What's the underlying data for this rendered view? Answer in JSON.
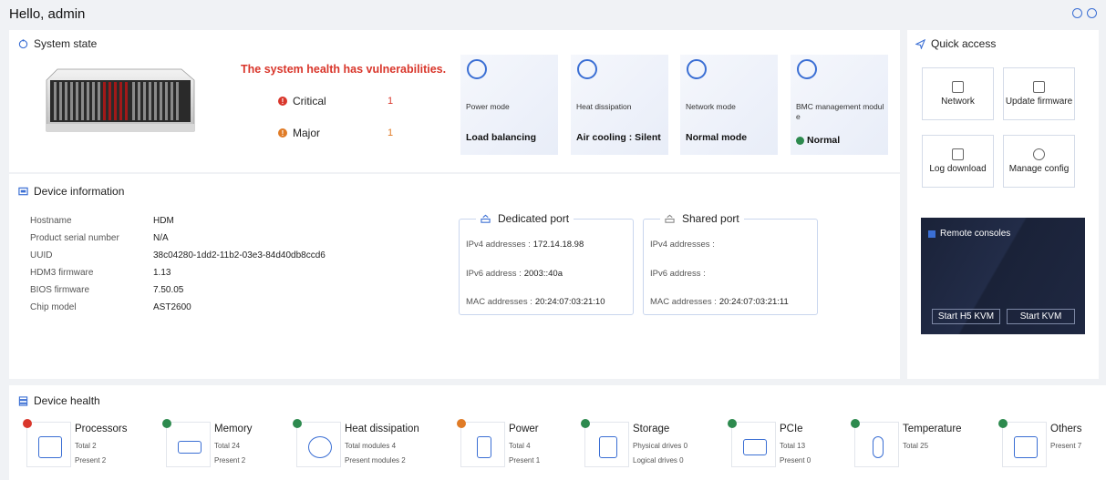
{
  "greeting": "Hello, admin",
  "colors": {
    "critical": "#d9362b",
    "major": "#e07b26",
    "ok": "#2d8a4e",
    "accent": "#3b6fd4"
  },
  "system_state": {
    "title": "System state",
    "alert": "The system health has vulnerabilities.",
    "critical_label": "Critical",
    "critical_count": "1",
    "major_label": "Major",
    "major_count": "1",
    "cards": [
      {
        "label": "Power mode",
        "value": "Load balancing",
        "icon": "power-icon"
      },
      {
        "label": "Heat dissipation",
        "value": "Air cooling : Silent",
        "icon": "fan-icon"
      },
      {
        "label": "Network mode",
        "value": "Normal mode",
        "icon": "network-icon"
      },
      {
        "label": "BMC management modul e",
        "value": "Normal",
        "icon": "bmc-icon"
      }
    ]
  },
  "device_info": {
    "title": "Device information",
    "rows": [
      {
        "label": "Hostname",
        "value": "HDM"
      },
      {
        "label": "Product serial number",
        "value": "N/A"
      },
      {
        "label": "UUID",
        "value": "38c04280-1dd2-11b2-03e3-84d40db8ccd6"
      },
      {
        "label": "HDM3 firmware",
        "value": "1.13"
      },
      {
        "label": "BIOS firmware",
        "value": "7.50.05"
      },
      {
        "label": "Chip model",
        "value": "AST2600"
      }
    ],
    "dedicated": {
      "title": "Dedicated port",
      "ipv4_label": "IPv4 addresses :",
      "ipv4": "172.14.18.98",
      "ipv6_label": "IPv6 address :",
      "ipv6": "2003::40a",
      "mac_label": "MAC addresses :",
      "mac": "20:24:07:03:21:10"
    },
    "shared": {
      "title": "Shared port",
      "ipv4_label": "IPv4 addresses :",
      "ipv4": "",
      "ipv6_label": "IPv6 address :",
      "ipv6": "",
      "mac_label": "MAC addresses :",
      "mac": "20:24:07:03:21:11"
    }
  },
  "quick_access": {
    "title": "Quick access",
    "buttons": [
      "Network",
      "Update firmware",
      "Log download",
      "Manage config"
    ],
    "remote_title": "Remote consoles",
    "start_h5": "Start H5 KVM",
    "start_kvm": "Start KVM"
  },
  "device_health": {
    "title": "Device health",
    "items": [
      {
        "name": "Processors",
        "s1": "Total 2",
        "s2": "Present 2",
        "status": "critical"
      },
      {
        "name": "Memory",
        "s1": "Total 24",
        "s2": "Present 2",
        "status": "ok"
      },
      {
        "name": "Heat dissipation",
        "s1": "Total modules 4",
        "s2": "Present modules 2",
        "status": "ok"
      },
      {
        "name": "Power",
        "s1": "Total 4",
        "s2": "Present 1",
        "status": "major"
      },
      {
        "name": "Storage",
        "s1": "Physical drives 0",
        "s2": "Logical drives 0",
        "status": "ok"
      },
      {
        "name": "PCIe",
        "s1": "Total 13",
        "s2": "Present 0",
        "status": "ok"
      },
      {
        "name": "Temperature",
        "s1": "Total 25",
        "s2": "",
        "status": "ok"
      },
      {
        "name": "Others",
        "s1": "Present 7",
        "s2": "",
        "status": "ok"
      }
    ]
  }
}
